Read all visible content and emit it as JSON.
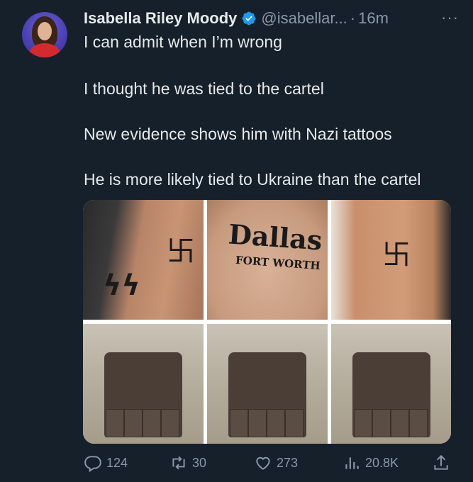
{
  "author": {
    "name": "Isabella Riley Moody",
    "handle": "@isabellar...",
    "separator": "·",
    "time": "16m",
    "more": "···"
  },
  "tweet": {
    "lines": [
      "I can admit when I’m wrong",
      "I thought he was tied to the cartel",
      "New evidence shows him with Nazi tattoos",
      "He is more likely tied to Ukraine than the cartel"
    ]
  },
  "media": {
    "tattoo_top": "Dallas",
    "tattoo_bottom": "FORT WORTH",
    "images": [
      "tattoo-arm-photo",
      "tattoo-chest-dallas-photo",
      "tattoo-chest-photo",
      "tactical-vest-photo",
      "tactical-vest-photo",
      "tactical-vest-photo"
    ]
  },
  "actions": {
    "replies": "124",
    "retweets": "30",
    "likes": "273",
    "views": "20.8K"
  },
  "colors": {
    "background": "#15202b",
    "text": "#e7e9ea",
    "muted": "#8b98a5",
    "verified": "#1d9bf0"
  }
}
